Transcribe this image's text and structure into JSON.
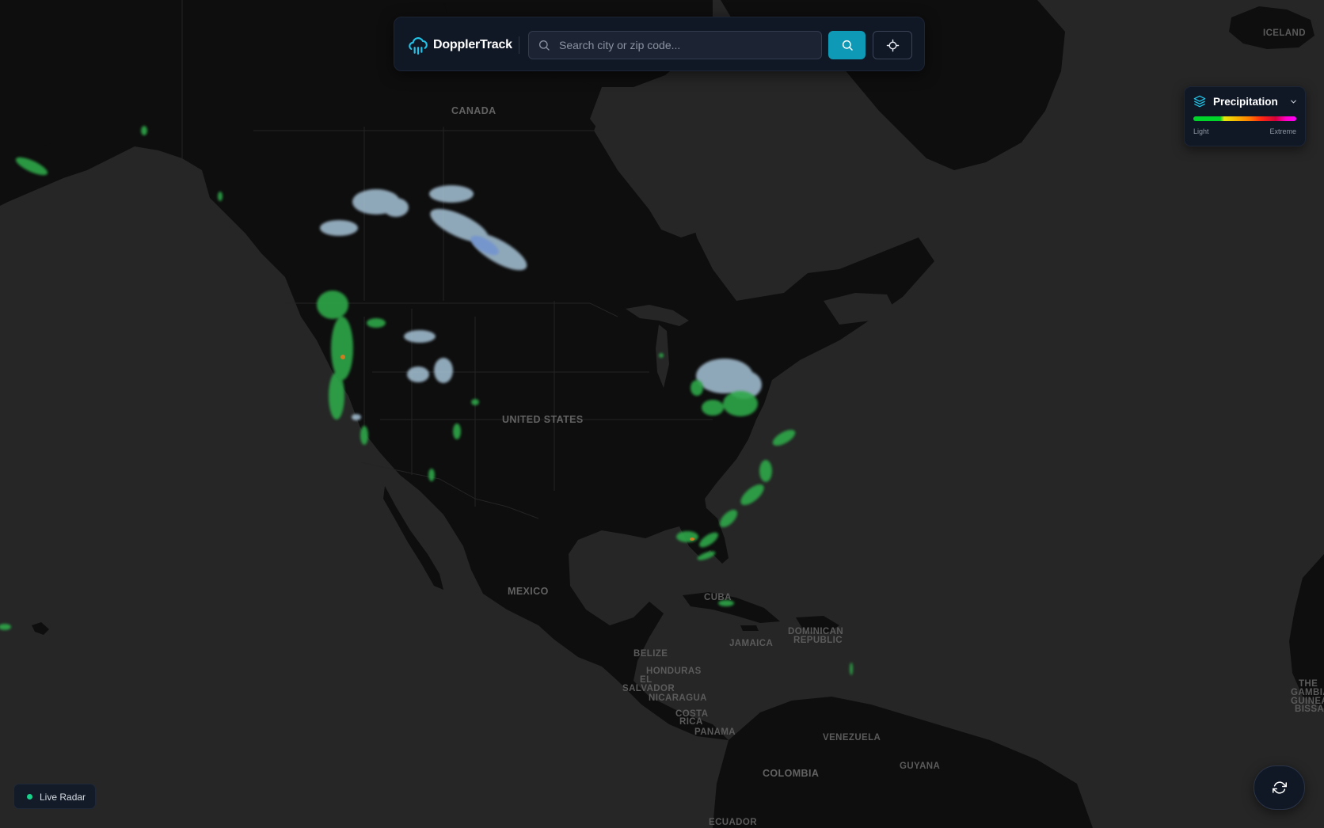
{
  "app": {
    "name": "DopplerTrack",
    "brand_icon": "cloud-rain-icon"
  },
  "search": {
    "placeholder": "Search city or zip code...",
    "value": "",
    "search_icon": "search-icon",
    "submit_icon": "search-icon",
    "locate_icon": "crosshair-icon"
  },
  "legend": {
    "layer": "Precipitation",
    "icon": "layers-icon",
    "dropdown_icon": "chevron-down-icon",
    "min_label": "Light",
    "max_label": "Extreme",
    "colors": [
      "#00d42a",
      "#e8e80c",
      "#f7b500",
      "#ff7f00",
      "#ff2a12",
      "#d4003c",
      "#ff00ff"
    ]
  },
  "status": {
    "label": "Live Radar",
    "dot_color": "#18d18a"
  },
  "controls": {
    "refresh_icon": "refresh-icon"
  },
  "theme": {
    "accent": "#0e9ab6",
    "panel": "#101826",
    "ocean": "#262626",
    "land": "#0e0e0e"
  },
  "map_labels": {
    "canada": "CANADA",
    "united_states": "UNITED STATES",
    "mexico": "MEXICO",
    "iceland": "ICELAND",
    "cuba": "CUBA",
    "jamaica": "JAMAICA",
    "dominican_republic_1": "DOMINICAN",
    "dominican_republic_2": "REPUBLIC",
    "belize": "BELIZE",
    "honduras": "HONDURAS",
    "el_salvador_1": "EL",
    "el_salvador_2": "SALVADOR",
    "nicaragua": "NICARAGUA",
    "costa_rica_1": "COSTA",
    "costa_rica_2": "RICA",
    "panama": "PANAMA",
    "venezuela": "VENEZUELA",
    "colombia": "COLOMBIA",
    "guyana": "GUYANA",
    "ecuador": "ECUADOR",
    "gambia_1": "THE",
    "gambia_2": "GAMBIA",
    "guinea_bissau_1": "GUINEA-",
    "guinea_bissau_2": "BISSAU"
  }
}
